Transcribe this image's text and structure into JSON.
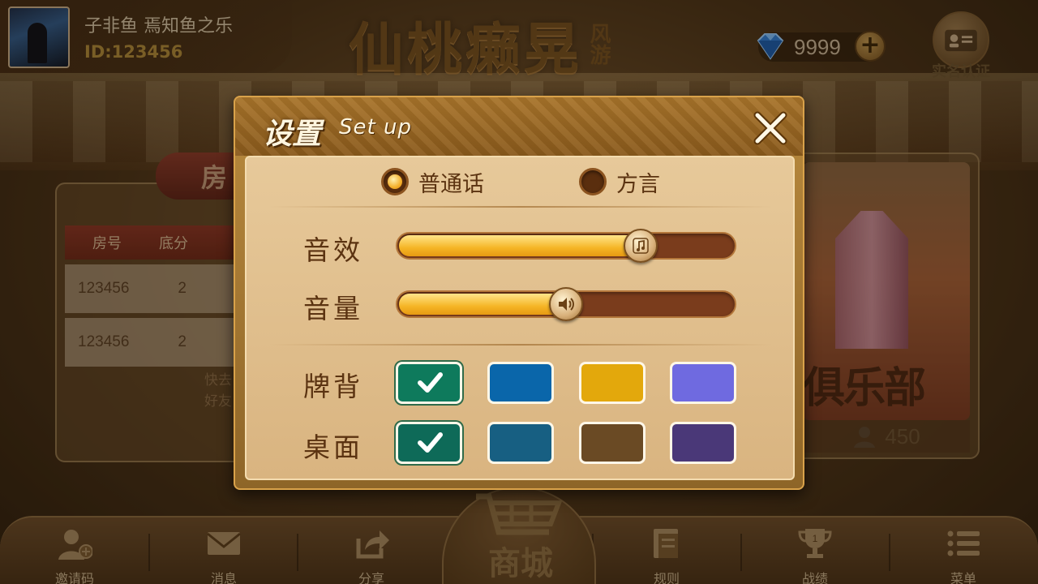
{
  "profile": {
    "nickname": "子非鱼 焉知鱼之乐",
    "user_id": "ID:123456"
  },
  "logo": {
    "main": "仙桃癞晃",
    "sub": "风游"
  },
  "currency": {
    "diamonds": "9999",
    "add": "+"
  },
  "realname": {
    "label": "实名认证"
  },
  "rooms": {
    "tab_label": "房",
    "headers": [
      "房号",
      "底分"
    ],
    "rows": [
      [
        "123456",
        "2"
      ],
      [
        "123456",
        "2"
      ]
    ],
    "tip": "快去好友"
  },
  "club": {
    "label": "俱乐部",
    "count": "450"
  },
  "settings": {
    "title": "设置",
    "subtitle": "Set up",
    "language_options": [
      {
        "label": "普通话",
        "selected": true
      },
      {
        "label": "方言",
        "selected": false
      }
    ],
    "sound_effect_label": "音效",
    "sound_effect_level": 0.72,
    "volume_label": "音量",
    "volume_level": 0.5,
    "card_back_label": "牌背",
    "card_back_colors": [
      "#0e7a5c",
      "#0a66aa",
      "#e3a80c",
      "#6f6ae0"
    ],
    "card_back_selected": 0,
    "table_label": "桌面",
    "table_colors": [
      "#0e6a58",
      "#175f82",
      "#6a4a24",
      "#4a3878"
    ],
    "table_selected": 0
  },
  "bottom_nav": {
    "invite": "邀请码",
    "messages": "消息",
    "share": "分享",
    "shop": "商城",
    "rules": "规则",
    "records": "战绩",
    "menu": "菜单"
  },
  "colors": {
    "accent_gold": "#f5b526",
    "modal_body": "#e1c08c",
    "text_brown": "#5b3311"
  }
}
